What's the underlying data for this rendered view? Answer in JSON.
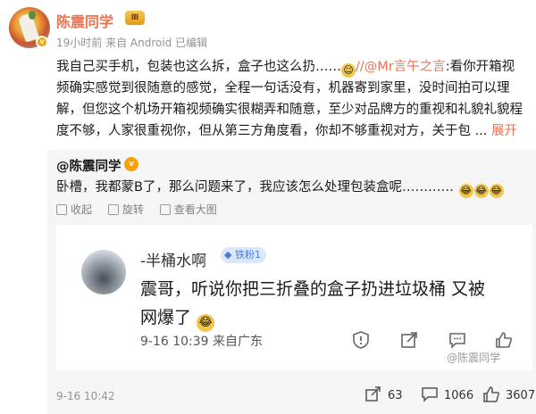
{
  "post": {
    "author": "陈震同学",
    "level_badge": "Ⅲ",
    "meta": "19小时前 来自 Android 已编辑",
    "text_before": "我自己买手机，包装也这么拆，盒子也这么扔……",
    "mention": "//@Mr言午之言",
    "text_after": ":看你开箱视频确实感觉到很随意的感觉，全程一句话没有，机器寄到家里，没时间拍可以理解，但您这个机场开箱视频确实很糊弄和随意，至少对品牌方的重视和礼貌礼貌程度不够，人家很重视你，但从第三方角度看，你却不够重视对方，关于包",
    "ellipsis": " ... ",
    "more_label": "展开"
  },
  "reply": {
    "author": "@陈震同学",
    "text": "卧槽，我都蒙B了，那么问题来了，我应该怎么处理包装盒呢…………",
    "actions": {
      "collect": "收起",
      "rotate": "旋转",
      "view_large": "查看大图"
    }
  },
  "card": {
    "name": "-半桶水啊",
    "fan_badge": "铁粉1",
    "text": "震哥，听说你把三折叠的盒子扔进垃圾桶 又被网爆了",
    "time": "9-16 10:39 来自广东"
  },
  "watermark": "@陈震同学",
  "footer": {
    "time": "9-16 10:42",
    "reposts": "63",
    "comments": "1066",
    "likes": "3607"
  }
}
